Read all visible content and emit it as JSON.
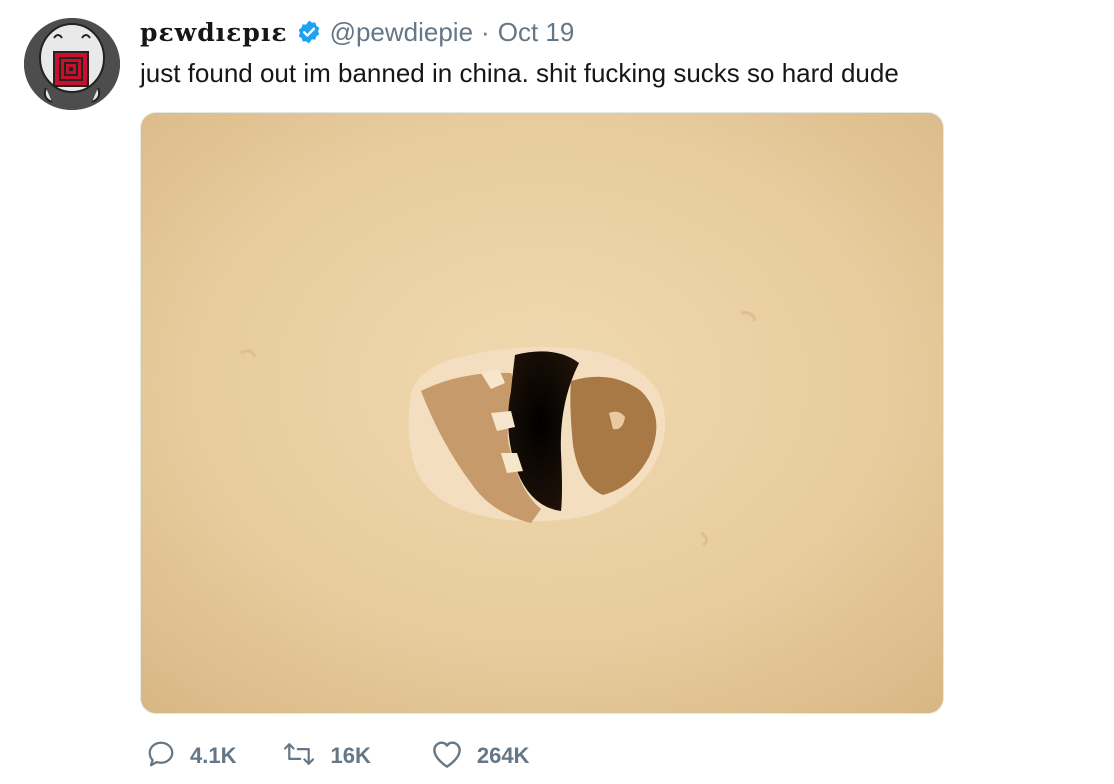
{
  "tweet": {
    "display_name": "pɛwdıɛpıɛ",
    "handle": "@pewdiepie",
    "separator": "·",
    "date": "Oct 19",
    "text": "just found out im banned in china. shit fucking sucks so hard dude"
  },
  "actions": {
    "reply_count": "4.1K",
    "retweet_count": "16K",
    "like_count": "264K"
  },
  "icons": {
    "reply": "speech-bubble-icon",
    "retweet": "retweet-arrows-icon",
    "like": "heart-icon",
    "verified": "verified-badge-icon"
  },
  "colors": {
    "verified": "#1da1f2",
    "secondary_text": "#657786",
    "wall": "#e8cfa4"
  }
}
